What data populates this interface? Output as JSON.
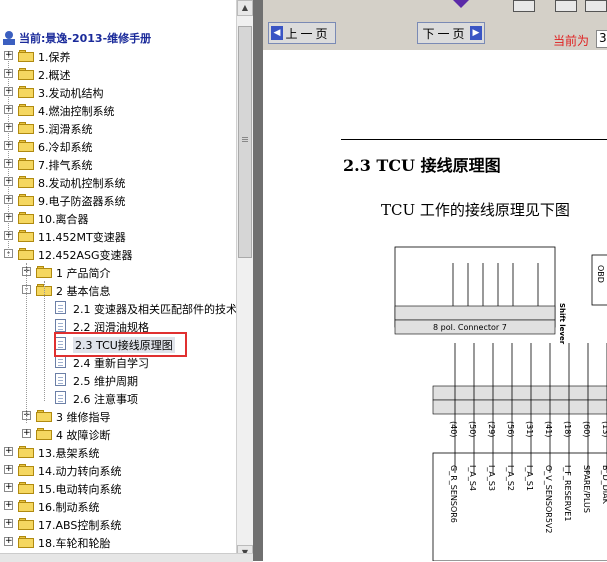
{
  "tree": {
    "title": "当前:景逸-2013-维修手册",
    "items": [
      {
        "label": "1.保养"
      },
      {
        "label": "2.概述"
      },
      {
        "label": "3.发动机结构"
      },
      {
        "label": "4.燃油控制系统"
      },
      {
        "label": "5.润滑系统"
      },
      {
        "label": "6.冷却系统"
      },
      {
        "label": "7.排气系统"
      },
      {
        "label": "8.发动机控制系统"
      },
      {
        "label": "9.电子防盗器系统"
      },
      {
        "label": "10.离合器"
      },
      {
        "label": "11.452MT变速器"
      },
      {
        "label": "12.452ASG变速器"
      }
    ],
    "sub12": [
      {
        "label": "1 产品简介"
      },
      {
        "label": "2 基本信息"
      }
    ],
    "sub2": [
      {
        "label": "2.1 变速器及相关匹配部件的技术"
      },
      {
        "label": "2.2 润滑油规格"
      },
      {
        "label": "2.3 TCU接线原理图"
      },
      {
        "label": "2.4 重新自学习"
      },
      {
        "label": "2.5 维护周期"
      },
      {
        "label": "2.6 注意事项"
      }
    ],
    "sub12b": [
      {
        "label": "3 维修指导"
      },
      {
        "label": "4 故障诊断"
      }
    ],
    "items2": [
      {
        "label": "13.悬架系统"
      },
      {
        "label": "14.动力转向系统"
      },
      {
        "label": "15.电动转向系统"
      },
      {
        "label": "16.制动系统"
      },
      {
        "label": "17.ABS控制系统"
      },
      {
        "label": "18.车轮和轮胎"
      }
    ]
  },
  "viewer": {
    "prev_label": "上一页",
    "next_label": "下一页",
    "current_page_label": "当前为",
    "page_value": "3"
  },
  "document": {
    "section_title": "2.3 TCU 接线原理图",
    "body": "TCU 工作的接线原理见下图",
    "diagram": {
      "connector_label": "8 pol. Connector 7",
      "shift_lever": "Shift lever",
      "obd": "OBD",
      "pins": [
        "(40)",
        "(50)",
        "(29)",
        "(56)",
        "(31)",
        "(41)",
        "(18)",
        "(60)",
        "(13)"
      ],
      "signals": [
        "G_R_SENSOR6",
        "I_A_S4",
        "I_A_S3",
        "I_A_S2",
        "I_A_S1",
        "O_V_SENSOR5V2",
        "I_F_RESERVE1",
        "SPARE/PLUS",
        "B_D_DIAK"
      ]
    }
  },
  "colors": {
    "tree_title": "#1a2a9a",
    "highlight_box": "#e03030",
    "current_page": "#e02020",
    "splitter": "#707070"
  }
}
